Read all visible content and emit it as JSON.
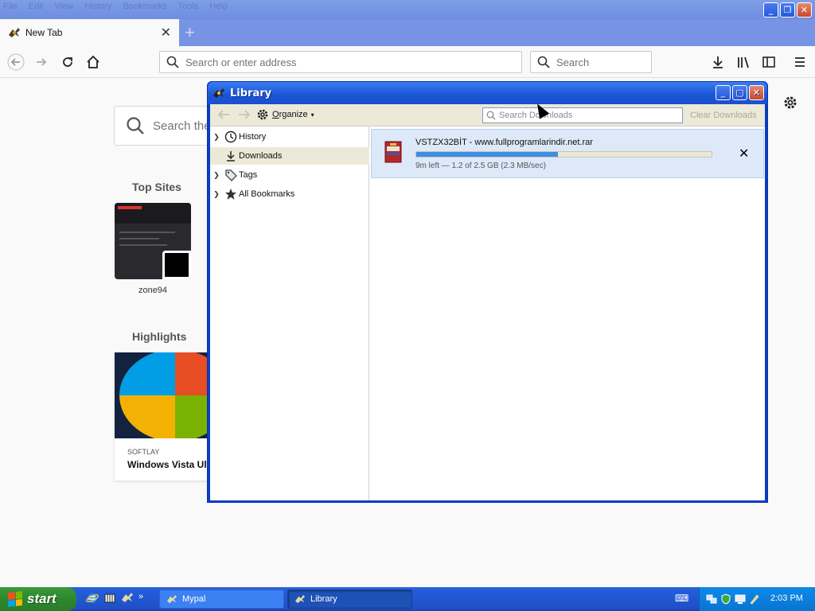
{
  "browser": {
    "menu": [
      "File",
      "Edit",
      "View",
      "History",
      "Bookmarks",
      "Tools",
      "Help"
    ],
    "window_controls": {
      "minimize": "_",
      "restore": "❐",
      "close": "✕"
    },
    "tab": {
      "title": "New Tab",
      "close": "✕"
    },
    "new_tab_symbol": "+",
    "urlbar": {
      "placeholder": "Search or enter address"
    },
    "searchbar": {
      "placeholder": "Search"
    }
  },
  "newtab": {
    "search_placeholder": "Search the",
    "top_sites_title": "Top Sites",
    "top_sites": [
      {
        "label": "zone94"
      }
    ],
    "highlights_title": "Highlights",
    "highlights": [
      {
        "source": "SOFTLAY",
        "title": "Windows Vista Ult"
      }
    ]
  },
  "library": {
    "title": "Library",
    "toolbar": {
      "organize_label": "Organize",
      "organize_underline": "O",
      "organize_rest": "rganize",
      "search_placeholder": "Search Downloads",
      "clear_label": "Clear Downloads"
    },
    "tree": [
      {
        "label": "History",
        "icon": "clock-icon",
        "expandable": true,
        "selected": false
      },
      {
        "label": "Downloads",
        "icon": "download-icon",
        "expandable": false,
        "selected": true
      },
      {
        "label": "Tags",
        "icon": "tag-icon",
        "expandable": true,
        "selected": false
      },
      {
        "label": "All Bookmarks",
        "icon": "star-icon",
        "expandable": true,
        "selected": false
      }
    ],
    "downloads": [
      {
        "filename": "VSTZX32BİT - www.fullprogramlarindir.net.rar",
        "progress": 0.48,
        "status": "9m left — 1.2 of 2.5 GB (2.3 MB/sec)",
        "cancel_symbol": "✕"
      }
    ]
  },
  "taskbar": {
    "start_label": "start",
    "quicklaunch_more": "»",
    "buttons": [
      {
        "label": "Mypal",
        "active": false
      },
      {
        "label": "Library",
        "active": true
      }
    ],
    "clock": "2:03 PM"
  },
  "colors": {
    "xp_blue": "#245edb",
    "download_progress": "#3d8ee6",
    "selected_row": "#ece9d8"
  }
}
